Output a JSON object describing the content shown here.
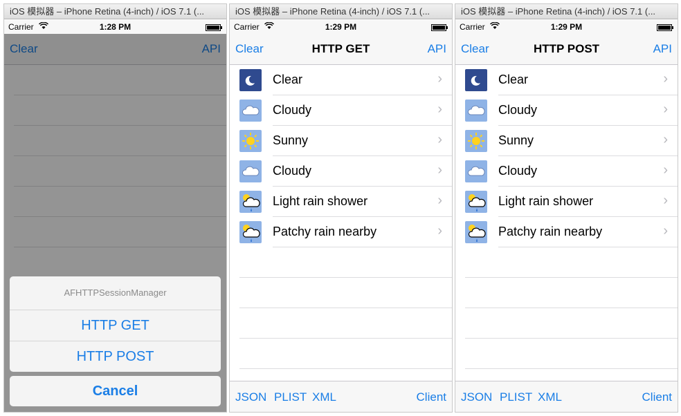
{
  "simulators": [
    {
      "window_title": "iOS 模拟器 – iPhone Retina (4-inch) / iOS 7.1 (...",
      "status": {
        "carrier": "Carrier",
        "time": "1:28 PM"
      },
      "nav": {
        "left": "Clear",
        "title": "",
        "right": "API"
      },
      "action_sheet": {
        "title": "AFHTTPSessionManager",
        "options": [
          "HTTP GET",
          "HTTP POST"
        ],
        "cancel": "Cancel"
      }
    },
    {
      "window_title": "iOS 模拟器 – iPhone Retina (4-inch) / iOS 7.1 (...",
      "status": {
        "carrier": "Carrier",
        "time": "1:29 PM"
      },
      "nav": {
        "left": "Clear",
        "title": "HTTP GET",
        "right": "API"
      },
      "rows": [
        {
          "label": "Clear",
          "icon": "moon-icon"
        },
        {
          "label": "Cloudy",
          "icon": "cloud-icon"
        },
        {
          "label": "Sunny",
          "icon": "sun-icon"
        },
        {
          "label": "Cloudy",
          "icon": "cloud-icon"
        },
        {
          "label": "Light rain shower",
          "icon": "sun-rain-icon"
        },
        {
          "label": "Patchy rain nearby",
          "icon": "sun-rain-icon"
        }
      ],
      "toolbar": {
        "json": "JSON",
        "plist": "PLIST",
        "xml": "XML",
        "client": "Client"
      }
    },
    {
      "window_title": "iOS 模拟器 – iPhone Retina (4-inch) / iOS 7.1 (...",
      "status": {
        "carrier": "Carrier",
        "time": "1:29 PM"
      },
      "nav": {
        "left": "Clear",
        "title": "HTTP POST",
        "right": "API"
      },
      "rows": [
        {
          "label": "Clear",
          "icon": "moon-icon"
        },
        {
          "label": "Cloudy",
          "icon": "cloud-icon"
        },
        {
          "label": "Sunny",
          "icon": "sun-icon"
        },
        {
          "label": "Cloudy",
          "icon": "cloud-icon"
        },
        {
          "label": "Light rain shower",
          "icon": "sun-rain-icon"
        },
        {
          "label": "Patchy rain nearby",
          "icon": "sun-rain-icon"
        }
      ],
      "toolbar": {
        "json": "JSON",
        "plist": "PLIST",
        "xml": "XML",
        "client": "Client"
      }
    }
  ],
  "colors": {
    "accent": "#1a7ee6",
    "moon_bg": "#2f4a8f",
    "weather_bg": "#8fb3e6"
  }
}
